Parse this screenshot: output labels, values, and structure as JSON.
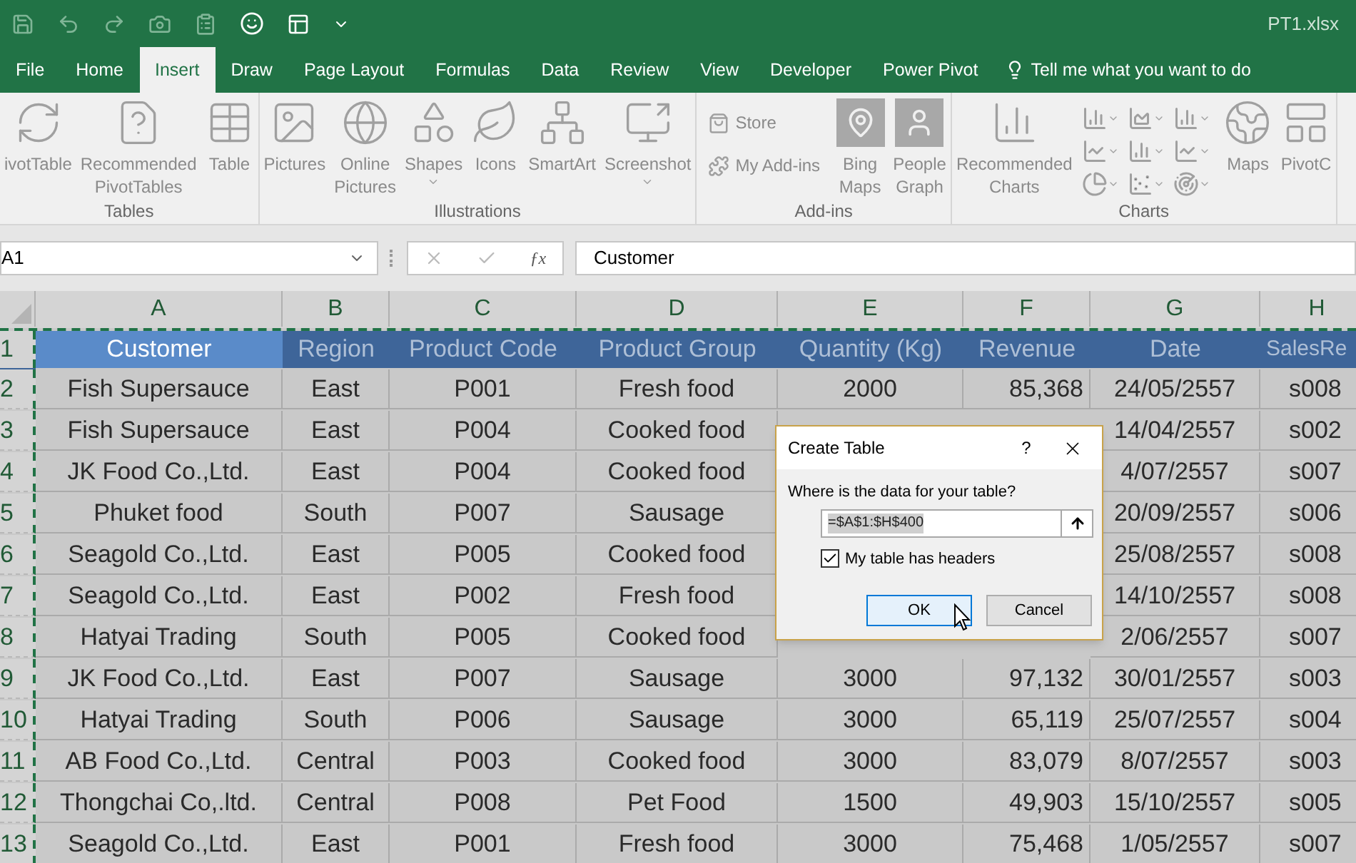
{
  "title_bar": {
    "filename": "PT1.xlsx"
  },
  "ribbon_tabs": [
    {
      "label": "File",
      "selected": false
    },
    {
      "label": "Home",
      "selected": false
    },
    {
      "label": "Insert",
      "selected": true
    },
    {
      "label": "Draw",
      "selected": false
    },
    {
      "label": "Page Layout",
      "selected": false
    },
    {
      "label": "Formulas",
      "selected": false
    },
    {
      "label": "Data",
      "selected": false
    },
    {
      "label": "Review",
      "selected": false
    },
    {
      "label": "View",
      "selected": false
    },
    {
      "label": "Developer",
      "selected": false
    },
    {
      "label": "Power Pivot",
      "selected": false
    }
  ],
  "tell_me": "Tell me what you want to do",
  "ribbon_groups": [
    {
      "label": "Tables",
      "items": [
        {
          "kind": "large",
          "label": "ivotTable"
        },
        {
          "kind": "large",
          "label": "Recommended PivotTables"
        },
        {
          "kind": "large",
          "label": "Table"
        }
      ]
    },
    {
      "label": "Illustrations",
      "items": [
        {
          "kind": "large",
          "label": "Pictures"
        },
        {
          "kind": "large",
          "label": "Online Pictures"
        },
        {
          "kind": "large",
          "label": "Shapes",
          "dropdown": true
        },
        {
          "kind": "large",
          "label": "Icons"
        },
        {
          "kind": "large",
          "label": "SmartArt"
        },
        {
          "kind": "large",
          "label": "Screenshot",
          "dropdown": true
        }
      ]
    },
    {
      "label": "Add-ins",
      "items": [
        {
          "kind": "stack",
          "entries": [
            {
              "label": "Store"
            },
            {
              "label": "My Add-ins"
            }
          ]
        },
        {
          "kind": "large",
          "label": "Bing Maps"
        },
        {
          "kind": "large",
          "label": "People Graph"
        }
      ]
    },
    {
      "label": "Charts",
      "items": [
        {
          "kind": "large",
          "label": "Recommended Charts"
        },
        {
          "kind": "chartgrid"
        },
        {
          "kind": "large",
          "label": "Maps"
        },
        {
          "kind": "large",
          "label": "PivotC"
        }
      ]
    }
  ],
  "formula_bar": {
    "name_box": "A1",
    "function_label": "ƒx",
    "content": "Customer"
  },
  "sheet": {
    "columns": [
      "A",
      "B",
      "C",
      "D",
      "E",
      "F",
      "G",
      "H"
    ],
    "header_row": {
      "number": "1",
      "cells": [
        {
          "text": "Customer",
          "selected": true
        },
        {
          "text": "Region",
          "selected": false
        },
        {
          "text": "Product Code",
          "selected": false
        },
        {
          "text": "Product Group",
          "selected": false
        },
        {
          "text": "Quantity (Kg)",
          "selected": false
        },
        {
          "text": "Revenue",
          "selected": false
        },
        {
          "text": "Date",
          "selected": false
        },
        {
          "text": "SalesRe",
          "selected": false
        }
      ]
    },
    "rows": [
      {
        "number": "2",
        "cells": [
          "Fish Supersauce",
          "East",
          "P001",
          "Fresh food",
          "2000",
          "85,368",
          "24/05/2557",
          "s008"
        ]
      },
      {
        "number": "3",
        "cells": [
          "Fish Supersauce",
          "East",
          "P004",
          "Cooked food",
          null,
          null,
          "14/04/2557",
          "s002"
        ]
      },
      {
        "number": "4",
        "cells": [
          "JK Food Co.,Ltd.",
          "East",
          "P004",
          "Cooked food",
          null,
          null,
          "4/07/2557",
          "s007"
        ]
      },
      {
        "number": "5",
        "cells": [
          "Phuket food",
          "South",
          "P007",
          "Sausage",
          null,
          null,
          "20/09/2557",
          "s006"
        ]
      },
      {
        "number": "6",
        "cells": [
          "Seagold Co.,Ltd.",
          "East",
          "P005",
          "Cooked food",
          null,
          null,
          "25/08/2557",
          "s008"
        ]
      },
      {
        "number": "7",
        "cells": [
          "Seagold Co.,Ltd.",
          "East",
          "P002",
          "Fresh food",
          null,
          null,
          "14/10/2557",
          "s008"
        ]
      },
      {
        "number": "8",
        "cells": [
          "Hatyai Trading",
          "South",
          "P005",
          "Cooked food",
          null,
          null,
          "2/06/2557",
          "s007"
        ]
      },
      {
        "number": "9",
        "cells": [
          "JK Food Co.,Ltd.",
          "East",
          "P007",
          "Sausage",
          "3000",
          "97,132",
          "30/01/2557",
          "s003"
        ]
      },
      {
        "number": "10",
        "cells": [
          "Hatyai Trading",
          "South",
          "P006",
          "Sausage",
          "3000",
          "65,119",
          "25/07/2557",
          "s004"
        ]
      },
      {
        "number": "11",
        "cells": [
          "AB Food Co.,Ltd.",
          "Central",
          "P003",
          "Cooked food",
          "3000",
          "83,079",
          "8/07/2557",
          "s003"
        ]
      },
      {
        "number": "12",
        "cells": [
          "Thongchai Co,.ltd.",
          "Central",
          "P008",
          "Pet Food",
          "1500",
          "49,903",
          "15/10/2557",
          "s005"
        ]
      },
      {
        "number": "13",
        "cells": [
          "Seagold Co.,Ltd.",
          "East",
          "P001",
          "Fresh food",
          "3000",
          "75,468",
          "1/05/2557",
          "s007"
        ]
      }
    ]
  },
  "dialog": {
    "title": "Create Table",
    "help": "?",
    "prompt": "Where is the data for your table?",
    "range": "=$A$1:$H$400",
    "headers_checkbox": {
      "label": "My table has headers",
      "checked": true
    },
    "buttons": [
      {
        "label": "OK",
        "focused": true
      },
      {
        "label": "Cancel",
        "focused": false
      }
    ]
  }
}
